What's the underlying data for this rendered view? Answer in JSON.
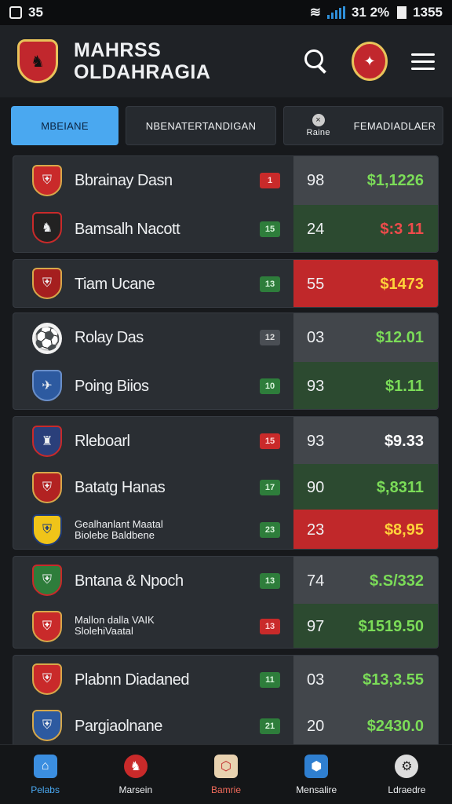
{
  "status": {
    "time": "35",
    "battery": "31 2%",
    "clock": "1355"
  },
  "header": {
    "title_line1": "MAHRSS",
    "title_line2": "OLDAHRAGIA"
  },
  "tabs": [
    {
      "label": "MBEIANE"
    },
    {
      "label": "NBENATERTANDIGAN"
    },
    {
      "sub": "Raine",
      "label": "FEMADIADLAER"
    }
  ],
  "groups": [
    {
      "rows": [
        {
          "name": "Bbrainay Dasn",
          "badge": "1",
          "badge_color": "red",
          "num": "98",
          "price": "$1,1226",
          "price_color": "green",
          "panel": "grey"
        },
        {
          "name": "Bamsalh Nacott",
          "badge": "15",
          "badge_color": "green",
          "num": "24",
          "price": "$:3 11",
          "price_color": "red",
          "panel": "green"
        }
      ]
    },
    {
      "rows": [
        {
          "name": "Tiam Ucane",
          "badge": "13",
          "badge_color": "green",
          "num": "55",
          "price": "$1473",
          "price_color": "yellow",
          "panel": "red"
        }
      ]
    },
    {
      "rows": [
        {
          "name": "Rolay Das",
          "badge": "12",
          "badge_color": "grey",
          "num": "03",
          "price": "$12.01",
          "price_color": "green",
          "panel": "grey",
          "logo": "ball"
        },
        {
          "name": "Poing Biios",
          "badge": "10",
          "badge_color": "green",
          "num": "93",
          "price": "$1.11",
          "price_color": "green",
          "panel": "green",
          "logo": "blue"
        }
      ]
    },
    {
      "rows": [
        {
          "name": "Rleboarl",
          "badge": "15",
          "badge_color": "red",
          "num": "93",
          "price": "$9.33",
          "price_color": "white",
          "panel": "grey"
        },
        {
          "name": "Batatg Hanas",
          "badge": "17",
          "badge_color": "green",
          "num": "90",
          "price": "$,8311",
          "price_color": "green",
          "panel": "green"
        },
        {
          "name": "Gealhanlant Maatal\nBiolebe Baldbene",
          "badge": "23",
          "badge_color": "green",
          "num": "23",
          "price": "$8,95",
          "price_color": "yellow",
          "panel": "red",
          "small": true
        }
      ]
    },
    {
      "rows": [
        {
          "name": "Bntana & Npoch",
          "badge": "13",
          "badge_color": "green",
          "num": "74",
          "price": "$.S/332",
          "price_color": "green",
          "panel": "grey"
        },
        {
          "name": "Mallon dalla VAIK\nSlolehiVaatal",
          "badge": "13",
          "badge_color": "red",
          "num": "97",
          "price": "$1519.50",
          "price_color": "green",
          "panel": "green",
          "small": true
        }
      ]
    },
    {
      "rows": [
        {
          "name": "Plabnn Diadaned",
          "badge": "11",
          "badge_color": "green",
          "num": "03",
          "price": "$13,3.55",
          "price_color": "green",
          "panel": "grey"
        },
        {
          "name": "Pargiaolnane",
          "badge": "21",
          "badge_color": "green",
          "num": "20",
          "price": "$2430.0",
          "price_color": "green",
          "panel": "grey"
        }
      ]
    }
  ],
  "bottom_nav": [
    {
      "label": "Pelabs",
      "icon": "home-icon"
    },
    {
      "label": "Marsein",
      "icon": "club-icon"
    },
    {
      "label": "Bamrie",
      "icon": "shield-icon"
    },
    {
      "label": "Mensalire",
      "icon": "hexagon-icon"
    },
    {
      "label": "Ldraedre",
      "icon": "settings-icon"
    }
  ]
}
